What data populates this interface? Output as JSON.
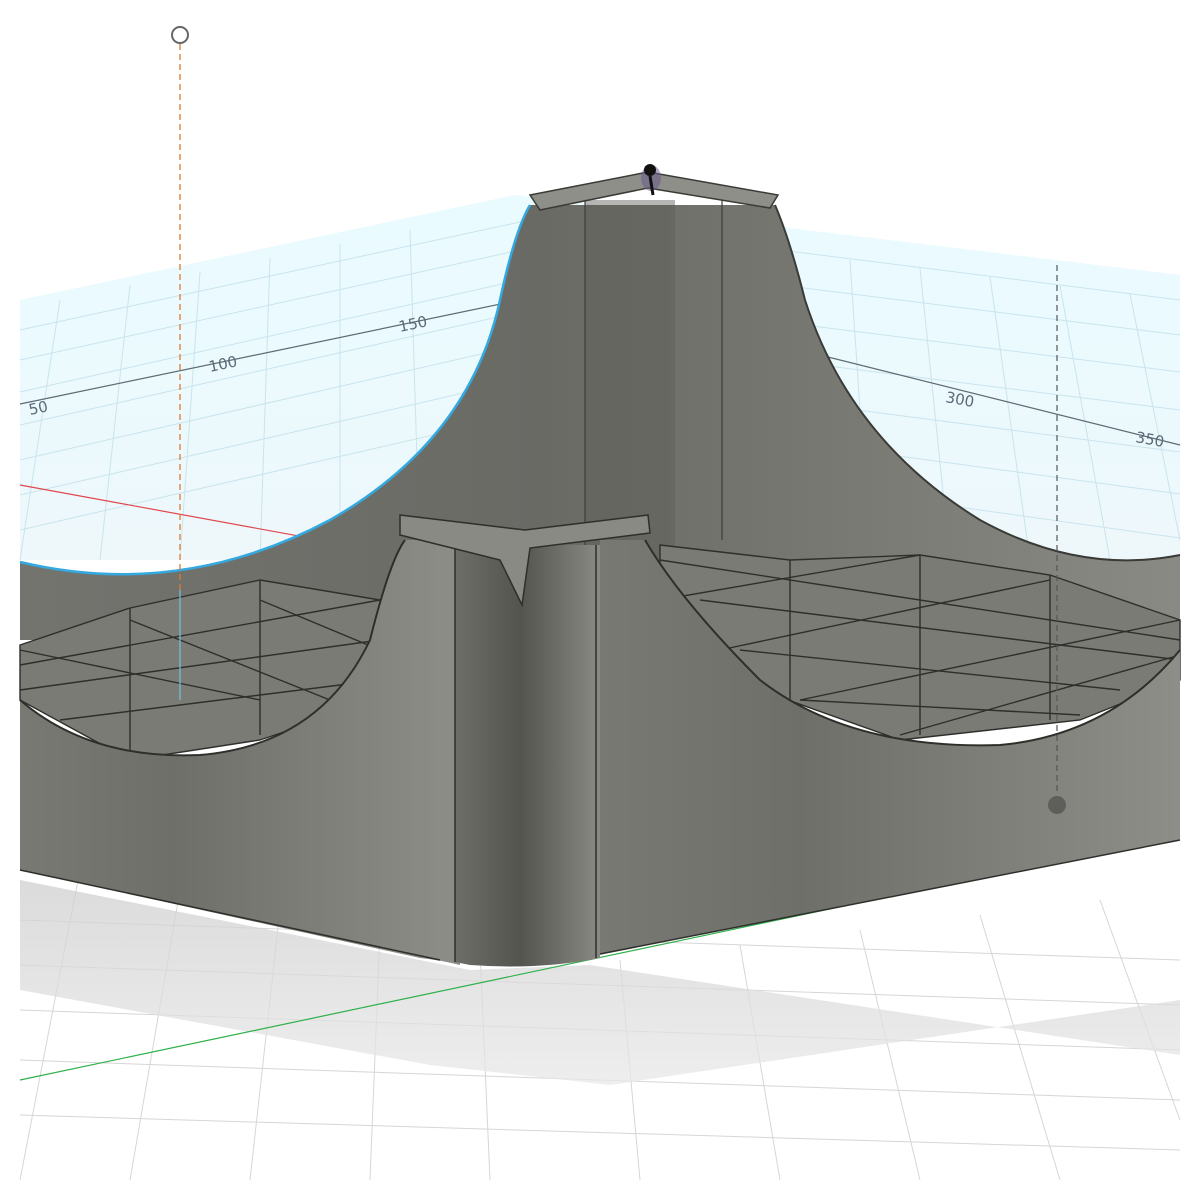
{
  "app": {
    "view": "3D modeling viewport",
    "model": "tray with curved walls and grid dividers"
  },
  "grid_rulers": {
    "labels": [
      "50",
      "100",
      "150",
      "300",
      "350"
    ]
  },
  "colors": {
    "background": "#ffffff",
    "grid_plane": "#e6f8fc",
    "grid_line_light": "#c9e4ee",
    "grid_line_major": "#5d6a73",
    "floor_grid": "#d4d4d4",
    "model_light": "#8c8c86",
    "model_mid": "#73736e",
    "model_dark": "#54544f",
    "axis_x": "#e0474c",
    "axis_y": "#2fb04a",
    "highlight_edge": "#33a9e0",
    "guide_orange": "#e07a2e",
    "guide_dark": "#555555"
  },
  "icons": {
    "pivot_handle": "pivot-handle-icon",
    "guide_endpoint_open": "open-circle-icon",
    "guide_endpoint_filled": "filled-circle-icon"
  }
}
